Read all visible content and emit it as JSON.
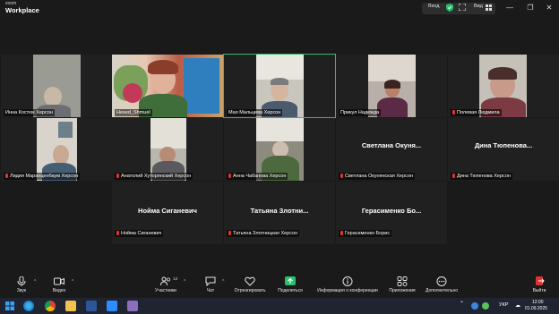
{
  "app": {
    "logo_top": "zoom",
    "logo_bottom": "Workplace"
  },
  "titlebar": {
    "sign_in": "Вход",
    "view": "Вид"
  },
  "participants": [
    {
      "name": "Инна Костюк Херсон"
    },
    {
      "name": "Hesed_Shmuel"
    },
    {
      "name": "Мая Мальцева Херсон"
    },
    {
      "name": "Прикул Надежда"
    },
    {
      "name": "Полевая Людмила"
    },
    {
      "name": "Лидия Маранценбаум Херсон"
    },
    {
      "name": "Анатолий Хуторянский Херсон"
    },
    {
      "name": "Анна Чабанова Херсон"
    },
    {
      "name": "Светлана Окунянская Херсон",
      "display": "Светлана Окуня..."
    },
    {
      "name": "Дина Тюпенова Херсон",
      "display": "Дина Тюпенова..."
    },
    {
      "name": "Нойма Сиганевич",
      "display": "Нойма Сиганевич"
    },
    {
      "name": "Татьяна Злотницкая Херсон",
      "display": "Татьяна Злотни..."
    },
    {
      "name": "Герасименко Борис",
      "display": "Герасименко Бо..."
    }
  ],
  "controls": {
    "audio": "Звук",
    "video": "Видео",
    "participants": "Участники",
    "participants_count": "13",
    "chat": "Чат",
    "react": "Отреагировать",
    "share": "Поделиться",
    "info": "Информация о конференции",
    "apps": "Приложения",
    "more": "Дополнительно",
    "leave": "Выйти"
  },
  "taskbar": {
    "lang": "УКР",
    "time": "12:00",
    "date": "01.09.2025"
  },
  "colors": {
    "accent": "#27c26b",
    "muted": "#e0332f",
    "leave": "#e0332f"
  }
}
